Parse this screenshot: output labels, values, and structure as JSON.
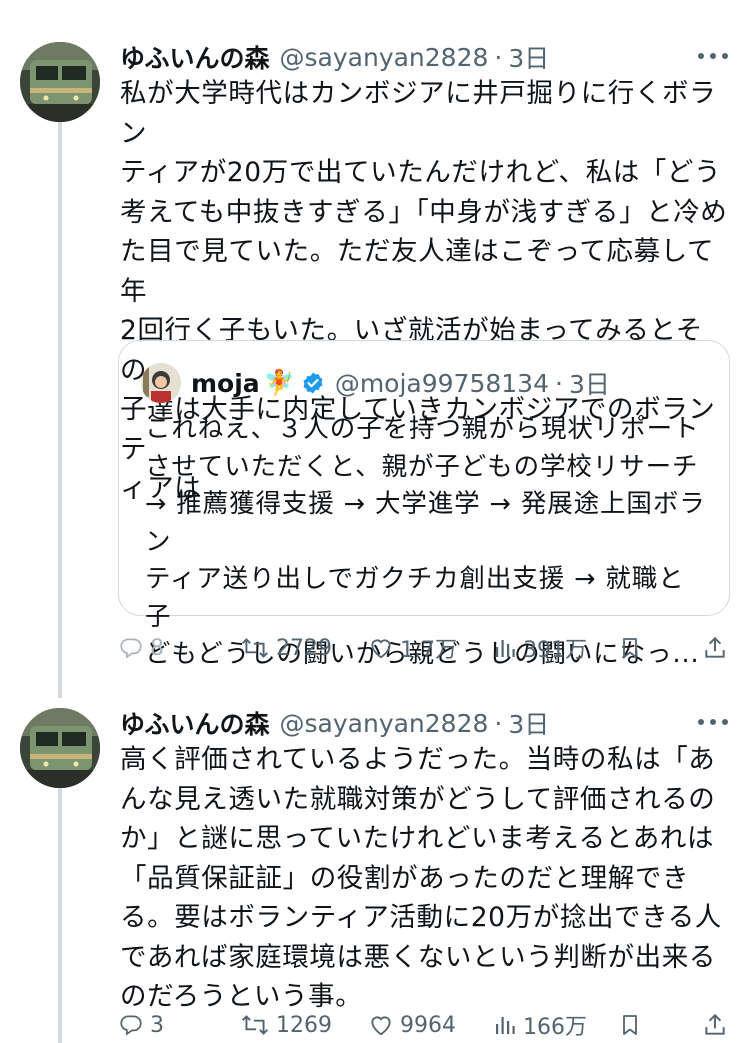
{
  "tweets": [
    {
      "author_name": "ゆふいんの森",
      "handle": "@sayanyan2828",
      "separator": "·",
      "time": "3日",
      "text": "私が大学時代はカンボジアに井戸掘りに行くボラン\nティアが20万で出ていたんだけれど、私は「どう\n考えても中抜きすぎる」「中身が浅すぎる」と冷め\nた目で見ていた。ただ友人達はこぞって応募して年\n2回行く子もいた。いざ就活が始まってみるとその\n子達は大手に内定していきカンボジアでのボランテ\nィアは",
      "quote": {
        "author_name": "moja",
        "emoji": "🧚",
        "handle": "@moja99758134",
        "separator": "·",
        "time": "3日",
        "text": "これねえ、３人の子を持つ親から現状リポート\nさせていただくと、親が子どもの学校リサーチ\n→ 推薦獲得支援 → 大学進学 → 発展途上国ボラン\nティア送り出しでガクチカ創出支援 → 就職と子\nどもどうしの闘いから親どうしの闘いになっ..."
      },
      "actions": {
        "replies": "8",
        "retweets": "2729",
        "likes": "1.7万",
        "views": "391万"
      }
    },
    {
      "author_name": "ゆふいんの森",
      "handle": "@sayanyan2828",
      "separator": "·",
      "time": "3日",
      "text": "高く評価されているようだった。当時の私は「あ\nんな見え透いた就職対策がどうして評価されるの\nか」と謎に思っていたけれどいま考えるとあれは\n「品質保証証」の役割があったのだと理解でき\nる。要はボランティア活動に20万が捻出できる人\nであれば家庭環境は悪くないという判断が出来る\nのだろうという事。",
      "actions": {
        "replies": "3",
        "retweets": "1269",
        "likes": "9964",
        "views": "166万"
      }
    }
  ],
  "colors": {
    "text": "#0f1419",
    "secondary": "#536471",
    "border": "#cfd9de",
    "verified": "#1d9bf0"
  },
  "icons": [
    "more-icon",
    "reply-icon",
    "retweet-icon",
    "like-icon",
    "views-icon",
    "bookmark-icon",
    "share-icon",
    "verified-badge-icon"
  ]
}
